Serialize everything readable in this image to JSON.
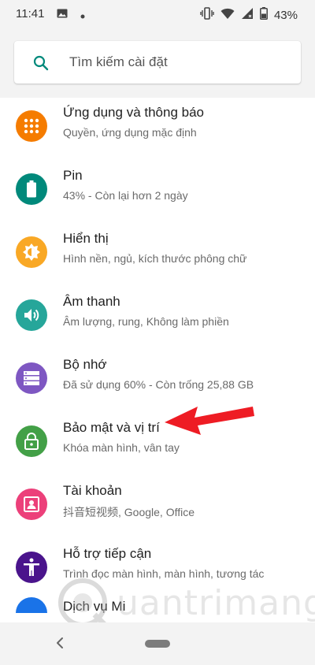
{
  "status_bar": {
    "time": "11:41",
    "battery": "43%",
    "icons": [
      "image-icon",
      "dot-icon",
      "vibrate-icon",
      "wifi-icon",
      "signal-icon",
      "battery-icon"
    ]
  },
  "search": {
    "placeholder": "Tìm kiếm cài đặt"
  },
  "settings": [
    {
      "title": "Ứng dụng và thông báo",
      "subtitle": "Quyền, ứng dụng mặc định",
      "icon": "apps-icon",
      "color": "#f57c00"
    },
    {
      "title": "Pin",
      "subtitle": "43% - Còn lại hơn 2 ngày",
      "icon": "battery-icon",
      "color": "#00897b"
    },
    {
      "title": "Hiển thị",
      "subtitle": "Hình nền, ngủ, kích thước phông chữ",
      "icon": "brightness-icon",
      "color": "#f9a825"
    },
    {
      "title": "Âm thanh",
      "subtitle": "Âm lượng, rung, Không làm phiền",
      "icon": "volume-icon",
      "color": "#26a69a"
    },
    {
      "title": "Bộ nhớ",
      "subtitle": "Đã sử dụng 60% - Còn trống 25,88 GB",
      "icon": "storage-icon",
      "color": "#7e57c2"
    },
    {
      "title": "Bảo mật và vị trí",
      "subtitle": "Khóa màn hình, vân tay",
      "icon": "lock-icon",
      "color": "#43a047"
    },
    {
      "title": "Tài khoản",
      "subtitle": "抖音短视频, Google, Office",
      "icon": "account-icon",
      "color": "#ec407a"
    },
    {
      "title": "Hỗ trợ tiếp cận",
      "subtitle": "Trình đọc màn hình, màn hình, tương tác",
      "icon": "accessibility-icon",
      "color": "#4a148c"
    }
  ],
  "partial_item": {
    "title": "Dịch vụ Mi"
  },
  "watermark": {
    "text": "uantrimang"
  }
}
